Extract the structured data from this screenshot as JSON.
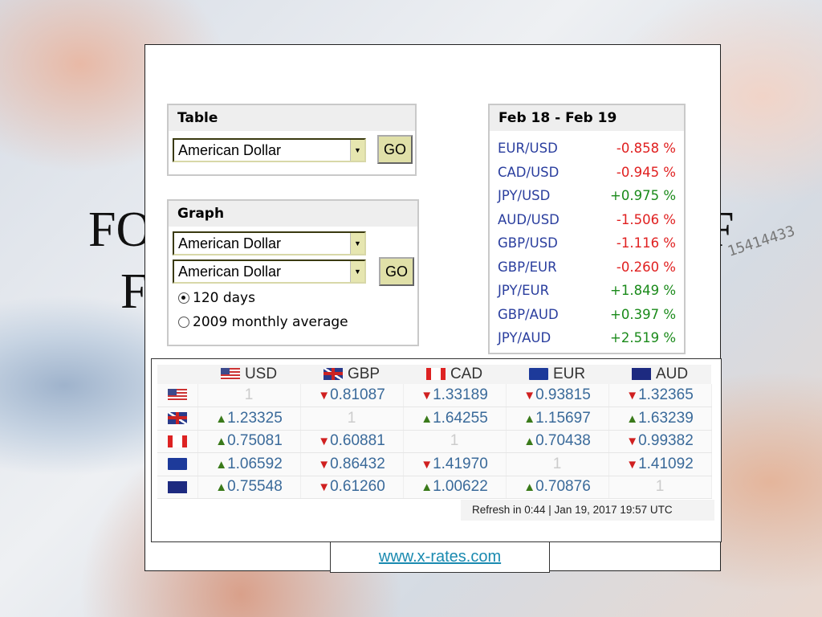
{
  "slide": {
    "title_fragments": {
      "line1_left": "FO",
      "line1_right": "F",
      "line2": "F"
    },
    "banknote_serial": "15414433",
    "link": "www.x-rates.com"
  },
  "table_widget": {
    "heading": "Table",
    "select_value": "American Dollar",
    "go_label": "GO"
  },
  "graph_widget": {
    "heading": "Graph",
    "from_value": "American Dollar",
    "to_value": "American Dollar",
    "go_label": "GO",
    "options": [
      {
        "label": "120 days",
        "selected": true
      },
      {
        "label": "2009 monthly average",
        "selected": false
      }
    ]
  },
  "changes": {
    "heading": "Feb 18 - Feb 19",
    "rows": [
      {
        "pair": "EUR/USD",
        "change": "-0.858 %"
      },
      {
        "pair": "CAD/USD",
        "change": "-0.945 %"
      },
      {
        "pair": "JPY/USD",
        "change": "+0.975 %"
      },
      {
        "pair": "AUD/USD",
        "change": "-1.506 %"
      },
      {
        "pair": "GBP/USD",
        "change": "-1.116 %"
      },
      {
        "pair": "GBP/EUR",
        "change": "-0.260 %"
      },
      {
        "pair": "JPY/EUR",
        "change": "+1.849 %"
      },
      {
        "pair": "GBP/AUD",
        "change": "+0.397 %"
      },
      {
        "pair": "JPY/AUD",
        "change": "+2.519 %"
      }
    ],
    "colors": {
      "negative": "#e02020",
      "positive": "#1a8a1a"
    }
  },
  "cross_rates": {
    "columns": [
      "USD",
      "GBP",
      "CAD",
      "EUR",
      "AUD"
    ],
    "flags": [
      "us",
      "gb",
      "ca",
      "eu",
      "au"
    ],
    "rows": [
      {
        "flag": "us",
        "cells": [
          {
            "v": "1",
            "t": ""
          },
          {
            "v": "0.81087",
            "t": "down"
          },
          {
            "v": "1.33189",
            "t": "down"
          },
          {
            "v": "0.93815",
            "t": "down"
          },
          {
            "v": "1.32365",
            "t": "down"
          }
        ]
      },
      {
        "flag": "gb",
        "cells": [
          {
            "v": "1.23325",
            "t": "up"
          },
          {
            "v": "1",
            "t": ""
          },
          {
            "v": "1.64255",
            "t": "up"
          },
          {
            "v": "1.15697",
            "t": "up"
          },
          {
            "v": "1.63239",
            "t": "up"
          }
        ]
      },
      {
        "flag": "ca",
        "cells": [
          {
            "v": "0.75081",
            "t": "up"
          },
          {
            "v": "0.60881",
            "t": "down"
          },
          {
            "v": "1",
            "t": ""
          },
          {
            "v": "0.70438",
            "t": "up"
          },
          {
            "v": "0.99382",
            "t": "down"
          }
        ]
      },
      {
        "flag": "eu",
        "cells": [
          {
            "v": "1.06592",
            "t": "up"
          },
          {
            "v": "0.86432",
            "t": "down"
          },
          {
            "v": "1.41970",
            "t": "down"
          },
          {
            "v": "1",
            "t": ""
          },
          {
            "v": "1.41092",
            "t": "down"
          }
        ]
      },
      {
        "flag": "au",
        "cells": [
          {
            "v": "0.75548",
            "t": "up"
          },
          {
            "v": "0.61260",
            "t": "down"
          },
          {
            "v": "1.00622",
            "t": "up"
          },
          {
            "v": "0.70876",
            "t": "up"
          },
          {
            "v": "1",
            "t": ""
          }
        ]
      }
    ],
    "refresh": "Refresh in 0:44 | Jan 19, 2017 19:57 UTC"
  }
}
